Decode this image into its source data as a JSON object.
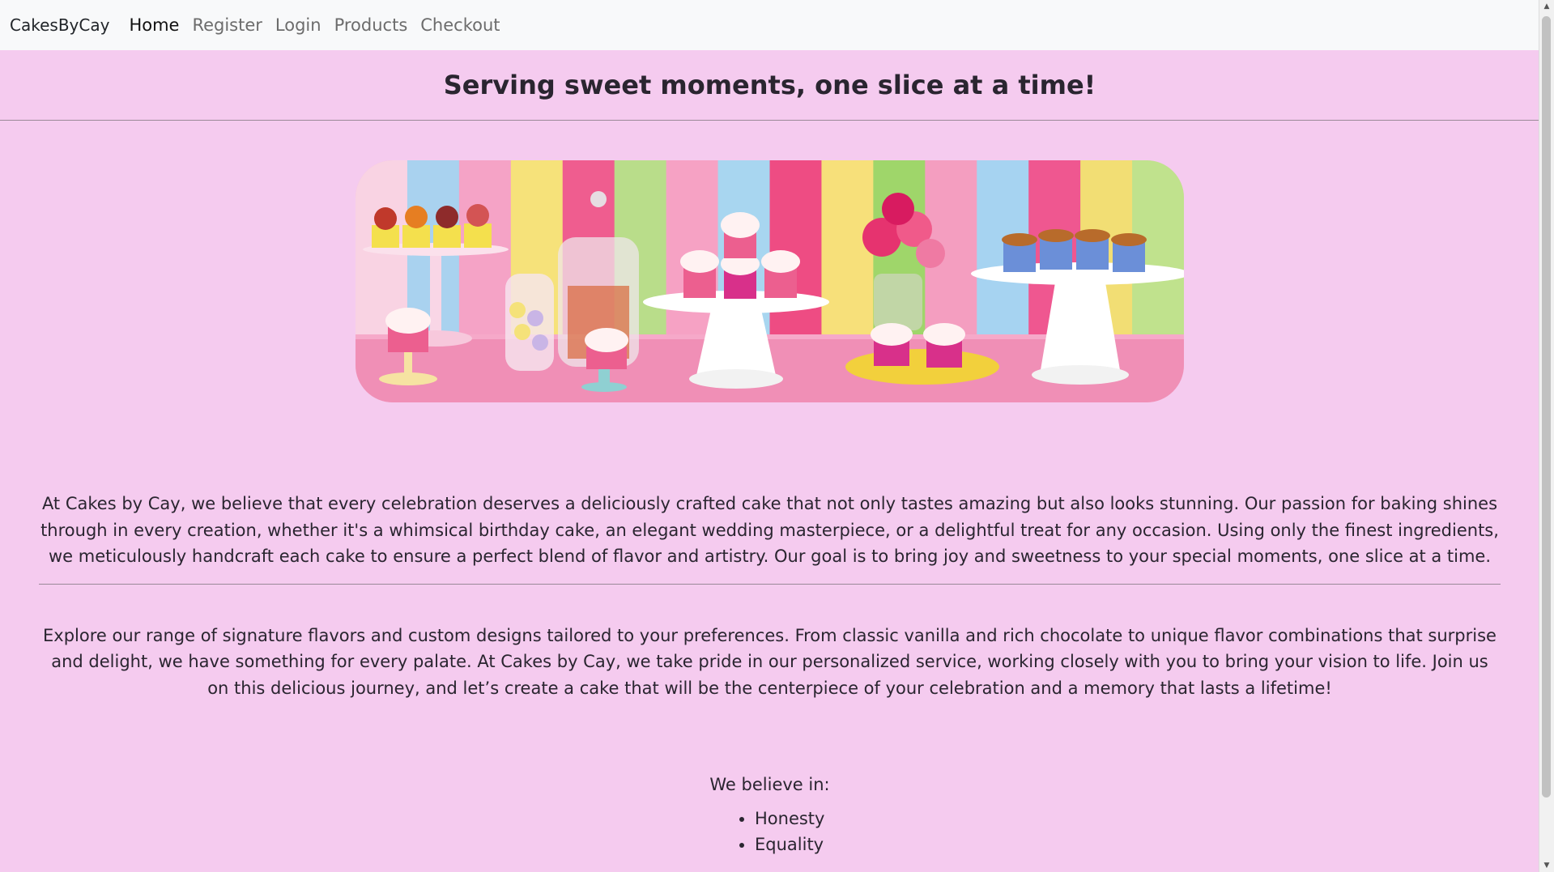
{
  "nav": {
    "brand": "CakesByCay",
    "links": [
      "Home",
      "Register",
      "Login",
      "Products",
      "Checkout"
    ],
    "active": "Home"
  },
  "header": {
    "title": "Serving sweet moments, one slice at a time!"
  },
  "about": {
    "paragraph1": "At Cakes by Cay, we believe that every celebration deserves a deliciously crafted cake that not only tastes amazing but also looks stunning. Our passion for baking shines through in every creation, whether it's a whimsical birthday cake, an elegant wedding masterpiece, or a delightful treat for any occasion. Using only the finest ingredients, we meticulously handcraft each cake to ensure a perfect blend of flavor and artistry. Our goal is to bring joy and sweetness to your special moments, one slice at a time.",
    "paragraph2": "Explore our range of signature flavors and custom designs tailored to your preferences. From classic vanilla and rich chocolate to unique flavor combinations that surprise and delight, we have something for every palate. At Cakes by Cay, we take pride in our personalized service, working closely with you to bring your vision to life. Join us on this delicious journey, and let’s create a cake that will be the centerpiece of your celebration and a memory that lasts a lifetime!"
  },
  "values": {
    "heading": "We believe in:",
    "items": [
      "Honesty",
      "Equality"
    ]
  },
  "colors": {
    "page_bg": "#f5cbef",
    "navbar_bg": "#f8f9fa"
  }
}
